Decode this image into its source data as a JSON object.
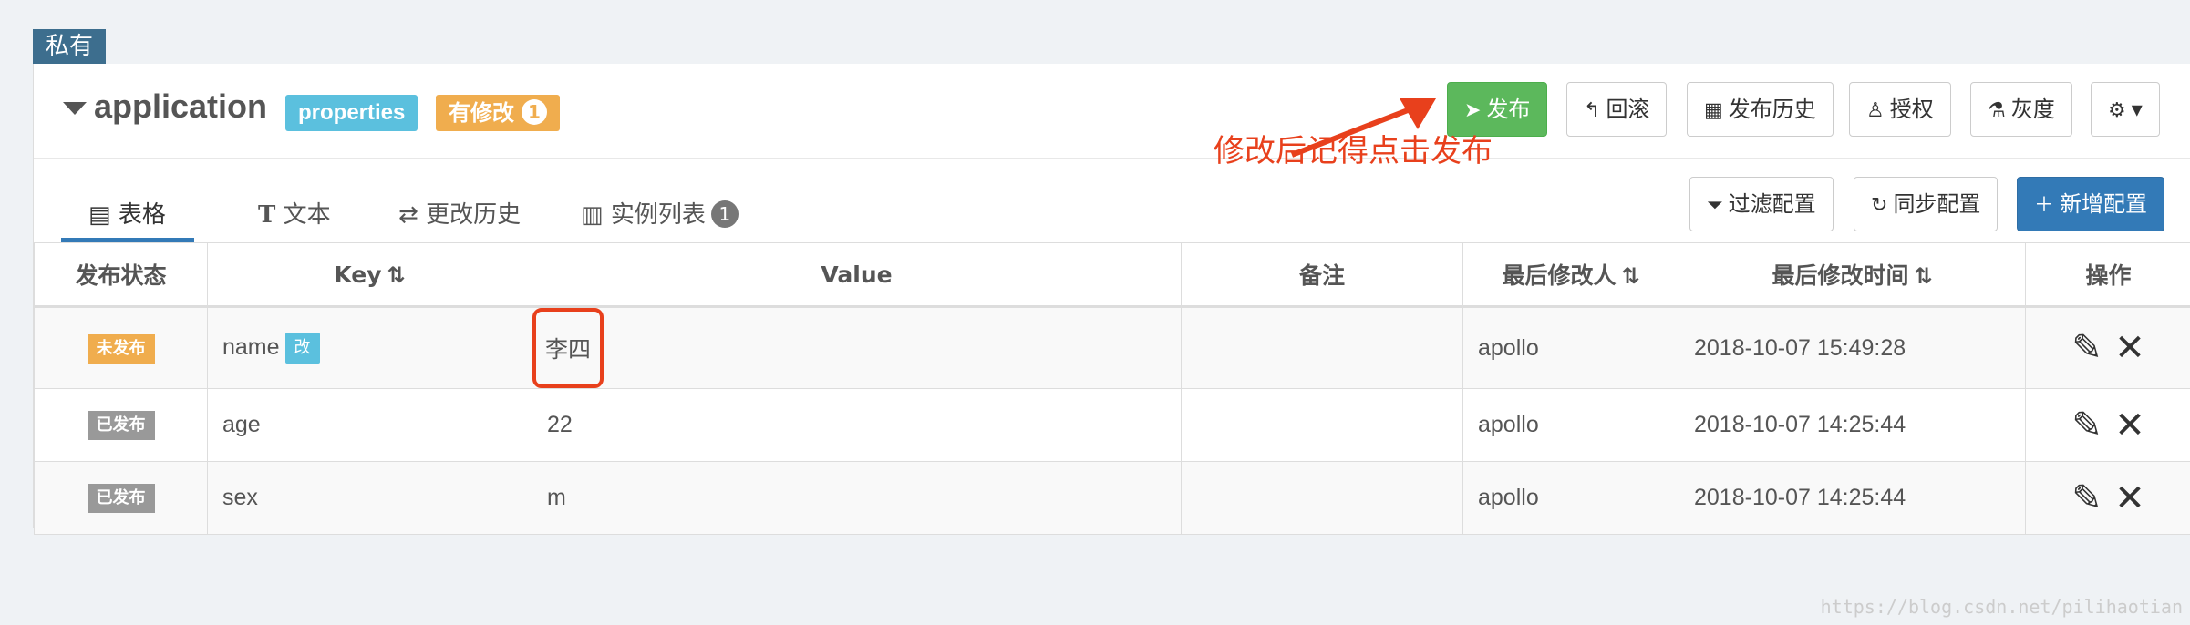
{
  "scope_tag": "私有",
  "namespace": {
    "title": "application",
    "format_label": "properties",
    "modified_label": "有修改",
    "modified_count": "1"
  },
  "toolbar": {
    "publish": "发布",
    "rollback": "回滚",
    "history": "发布历史",
    "authorize": "授权",
    "gray": "灰度"
  },
  "annotation": "修改后记得点击发布",
  "tabs": [
    {
      "label": "表格"
    },
    {
      "label": "文本"
    },
    {
      "label": "更改历史"
    },
    {
      "label": "实例列表",
      "badge": "1"
    }
  ],
  "actions": {
    "filter": "过滤配置",
    "sync": "同步配置",
    "add": "新增配置"
  },
  "table": {
    "columns": [
      "发布状态",
      "Key",
      "Value",
      "备注",
      "最后修改人",
      "最后修改时间",
      "操作"
    ],
    "rows": [
      {
        "status": "未发布",
        "key": "name",
        "key_badge": "改",
        "value": "李四",
        "comment": "",
        "modifier": "apollo",
        "time": "2018-10-07 15:49:28"
      },
      {
        "status": "已发布",
        "key": "age",
        "value": "22",
        "comment": "",
        "modifier": "apollo",
        "time": "2018-10-07 14:25:44"
      },
      {
        "status": "已发布",
        "key": "sex",
        "value": "m",
        "comment": "",
        "modifier": "apollo",
        "time": "2018-10-07 14:25:44"
      }
    ]
  },
  "watermark": "https://blog.csdn.net/pilihaotian"
}
